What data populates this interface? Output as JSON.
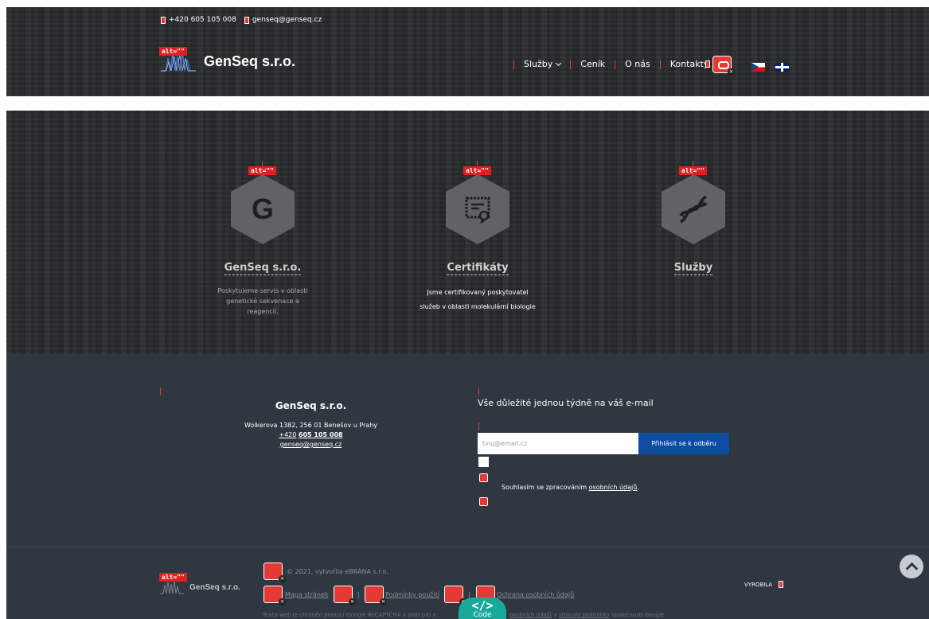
{
  "header": {
    "phone": "+420 605 105 008",
    "email": "genseq@genseq.cz",
    "logo_alt": "alt=\"\"",
    "logo_text": "GenSeq s.r.o.",
    "nav": {
      "services": "Služby",
      "pricing": "Ceník",
      "about": "O nás",
      "contacts": "Kontakty"
    }
  },
  "features": [
    {
      "alt": "alt=\"\"",
      "letter": "G",
      "title": "GenSeq s.r.o.",
      "desc": "Poskytujeme servis v oblasti genetické sekvenace a reagencií."
    },
    {
      "alt": "alt=\"\"",
      "title": "Certifikáty",
      "desc": "Jsme certifikovaný poskytovatel služeb v oblasti molekulární biologie"
    },
    {
      "alt": "alt=\"\"",
      "title": "Služby",
      "desc": ""
    }
  ],
  "contact": {
    "name": "GenSeq s.r.o.",
    "address": "Wolkerova 1382, 256 01 Benešov u Prahy",
    "phone_prefix": "+420",
    "phone_main": "605 105 008",
    "email": "genseq@genseq.cz"
  },
  "newsletter": {
    "title": "Vše důležité jednou týdně na váš e-mail",
    "placeholder": "tvuj@email.cz",
    "button": "Přihlásit se k odběru",
    "agree_prefix": "Souhlasím se zpracováním",
    "agree_link": "osobních údajů",
    "agree_suffix": "."
  },
  "bottom": {
    "logo_alt": "alt=\"\"",
    "logo_text": "GenSeq s.r.o.",
    "copyright": "© 2021, vytvořila eBRÁNA s.r.o.",
    "sitemap": "Mapa stránek",
    "separator": "|",
    "terms": "Podmínky použití",
    "privacy": "Ochrana osobních údajů",
    "recaptcha_prefix": "Tento web je chráněn pomocí Google ReCAPTCHA a platí pro n",
    "recaptcha_link1": "osobních údajů",
    "recaptcha_and": "a",
    "recaptcha_link2": "smluvní podmínky",
    "recaptcha_suffix": "společnosti Google.",
    "made_by": "VYROBILA",
    "code_label": "Code",
    "code_glyph": "</>"
  },
  "colors": {
    "header_bg": "#262729",
    "footer_bg": "#2f3740",
    "accent_red": "#e53935",
    "button_blue": "#0c4da2",
    "code_teal": "#1aa89a"
  }
}
